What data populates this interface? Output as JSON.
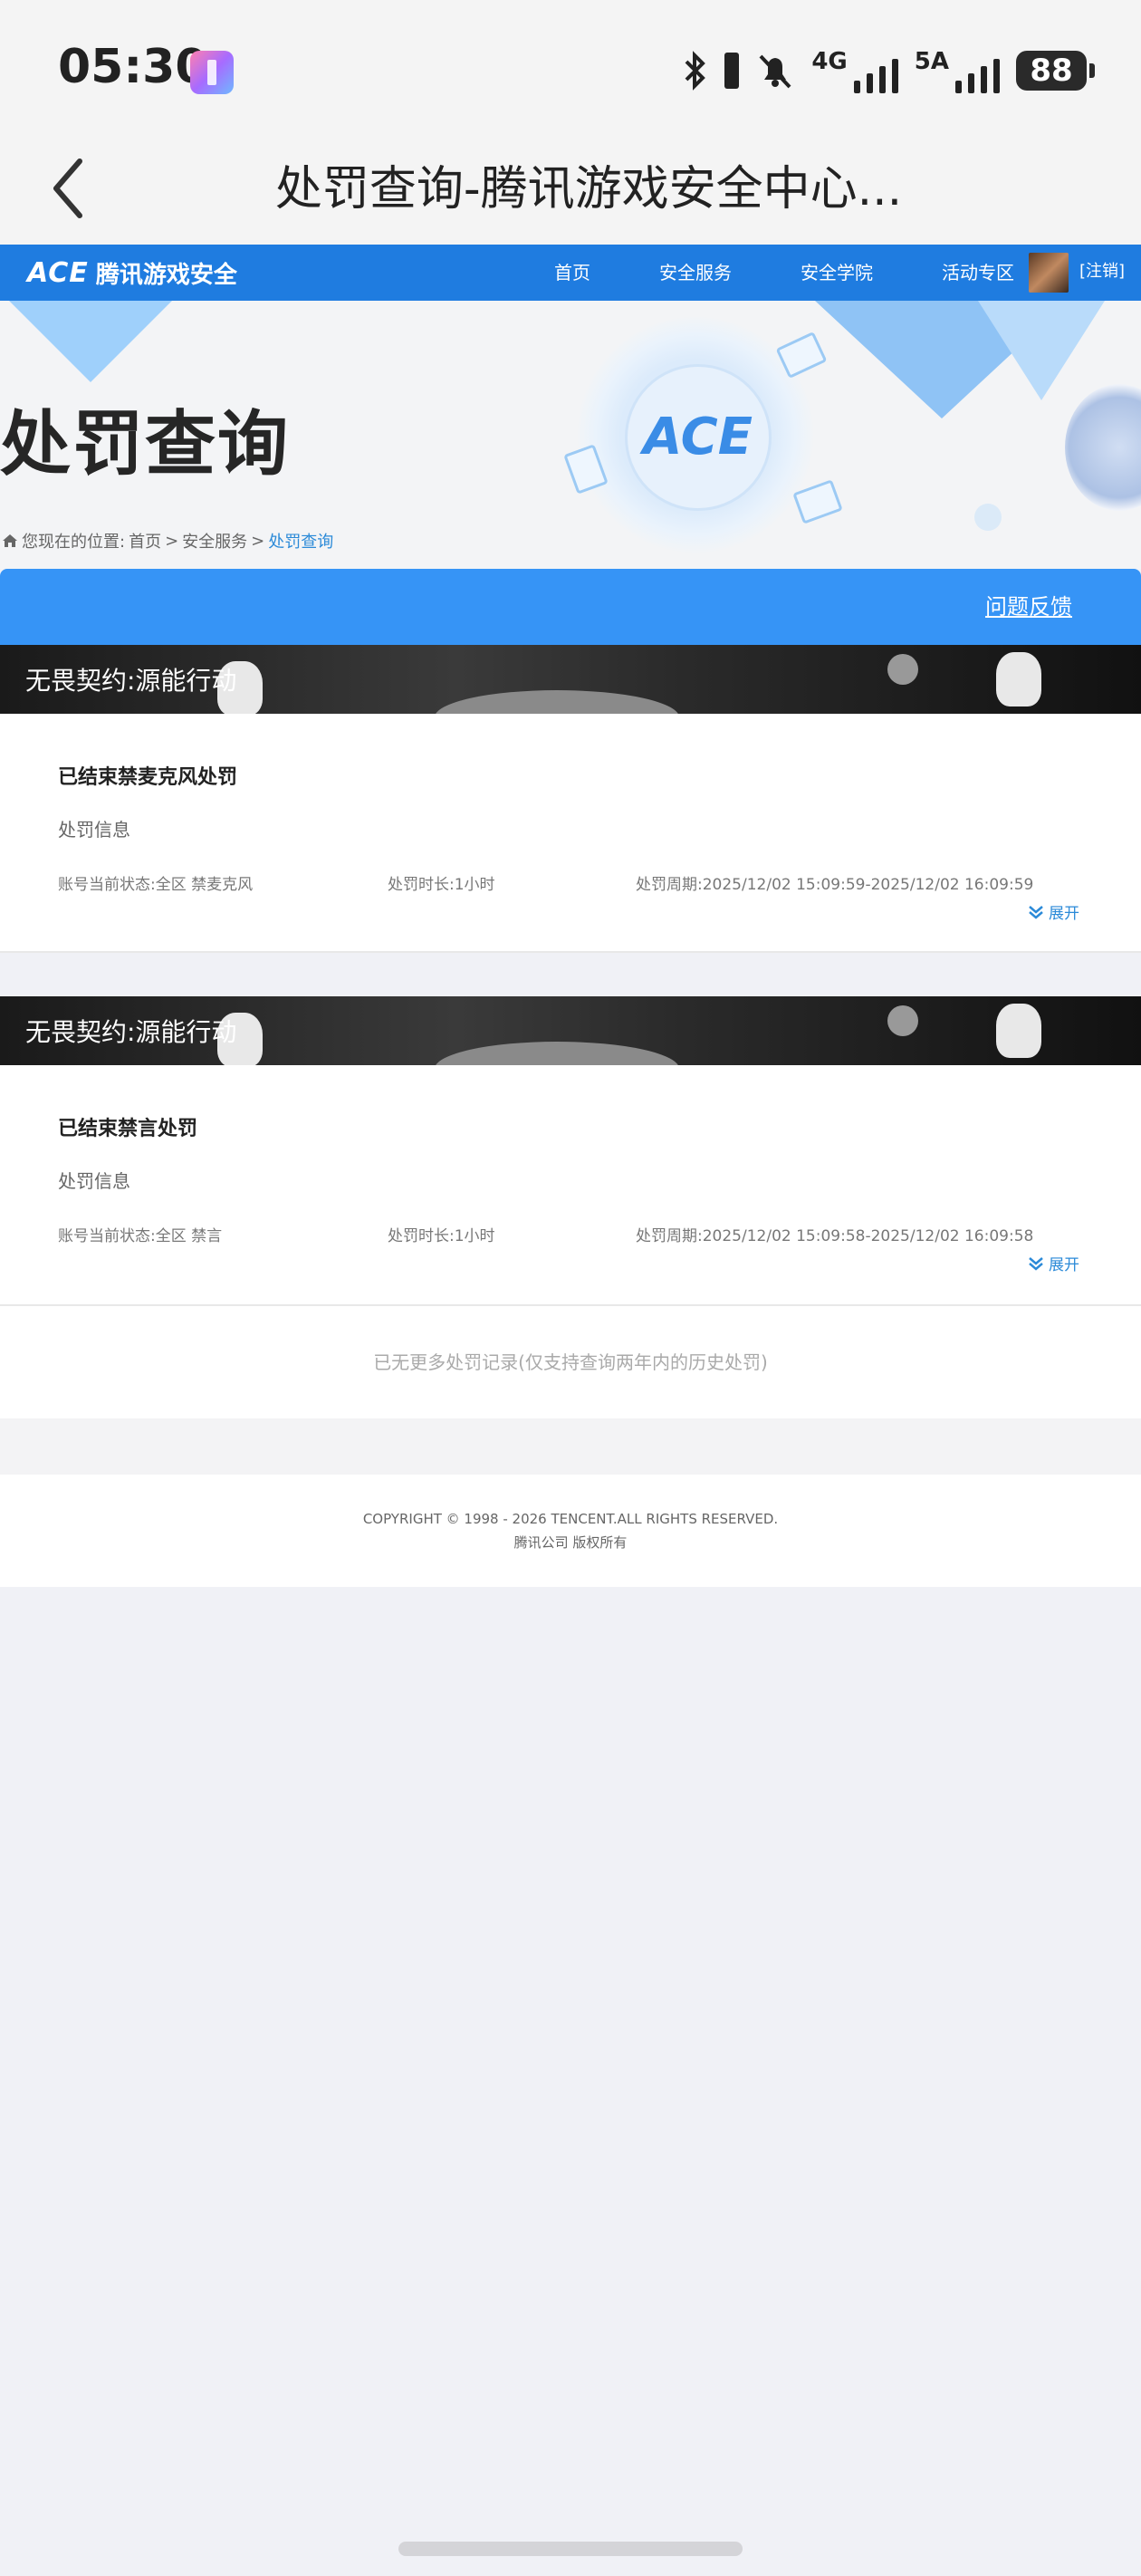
{
  "status_bar": {
    "time": "05:30",
    "network_1": "4G",
    "network_2": "5A",
    "battery": "88"
  },
  "title_bar": {
    "title": "处罚查询-腾讯游戏安全中心..."
  },
  "site_header": {
    "logo_mark": "ACE",
    "logo_text": "腾讯游戏安全",
    "nav": [
      "首页",
      "安全服务",
      "安全学院",
      "活动专区"
    ],
    "logout": "[注销]"
  },
  "hero": {
    "title": "处罚查询",
    "logo_mark": "ACE",
    "breadcrumb_prefix": "您现在的位置:",
    "breadcrumb_home": "首页",
    "breadcrumb_sep": ">",
    "breadcrumb_service": "安全服务",
    "breadcrumb_current": "处罚查询"
  },
  "feedback": {
    "label": "问题反馈"
  },
  "records": [
    {
      "banner": "无畏契约:源能行动",
      "title": "已结束禁麦克风处罚",
      "subtitle": "处罚信息",
      "status": "账号当前状态:全区 禁麦克风",
      "duration": "处罚时长:1小时",
      "period": "处罚周期:2025/12/02 15:09:59-2025/12/02 16:09:59",
      "expand": "展开"
    },
    {
      "banner": "无畏契约:源能行动",
      "title": "已结束禁言处罚",
      "subtitle": "处罚信息",
      "status": "账号当前状态:全区 禁言",
      "duration": "处罚时长:1小时",
      "period": "处罚周期:2025/12/02 15:09:58-2025/12/02 16:09:58",
      "expand": "展开"
    }
  ],
  "no_more": "已无更多处罚记录(仅支持查询两年内的历史处罚)",
  "footer": {
    "copyright": "COPYRIGHT © 1998 - 2026 TENCENT.ALL RIGHTS RESERVED.",
    "company": "腾讯公司 版权所有"
  },
  "colors": {
    "header_blue": "#1f7ce0",
    "feedback_blue": "#3694f6",
    "link_blue": "#2b8ad8"
  }
}
